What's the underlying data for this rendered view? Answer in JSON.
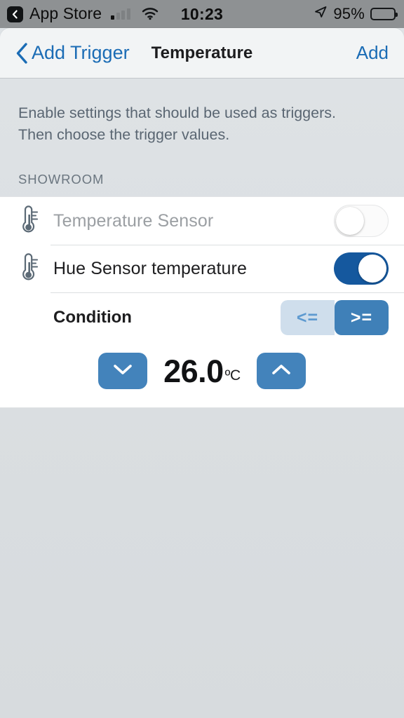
{
  "status_bar": {
    "back_icon": "back-chevron-icon",
    "carrier": "App Store",
    "signal_icon": "cellular-signal-icon",
    "signal_bars_active": 1,
    "wifi_icon": "wifi-icon",
    "time": "10:23",
    "location_icon": "location-arrow-icon",
    "battery_percent": "95%",
    "battery_icon": "battery-full-icon"
  },
  "nav_bar": {
    "back_icon": "chevron-left-icon",
    "back_label": "Add Trigger",
    "title": "Temperature",
    "action_label": "Add"
  },
  "content": {
    "description": "Enable settings that should be used as triggers. Then choose the trigger values.",
    "section_header": "SHOWROOM"
  },
  "rows": [
    {
      "icon": "thermometer-icon",
      "label": "Temperature Sensor",
      "toggle_state": "off",
      "enabled": false
    },
    {
      "icon": "thermometer-icon",
      "label": "Hue Sensor temperature",
      "toggle_state": "on",
      "enabled": true
    }
  ],
  "condition": {
    "label": "Condition",
    "options": [
      {
        "label": "<=",
        "selected": false
      },
      {
        "label": ">=",
        "selected": true
      }
    ]
  },
  "stepper": {
    "decrement_icon": "chevron-down-icon",
    "increment_icon": "chevron-up-icon",
    "value": "26.0",
    "unit": "ºC"
  },
  "colors": {
    "accent_blue": "#1b6cb5",
    "toggle_on": "#15589e",
    "segment_selected": "#3f80b8",
    "segment_unselected": "#cfdeec",
    "stepper_button": "#4383bb",
    "page_background": "#dde1e4",
    "card_background": "#ffffff"
  }
}
